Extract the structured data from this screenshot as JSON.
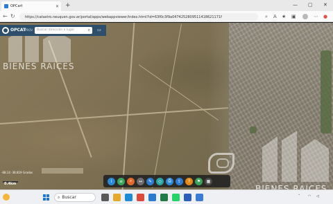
{
  "browser": {
    "tab_title": "OPCart",
    "url": "https://catastro.neuquen.gov.ar/portal/apps/webappviewer/index.html?id=63f0c3f9a0474252809511418621171f",
    "new_tab_label": "+",
    "minimize": "—",
    "maximize": "▢",
    "close": "✕"
  },
  "app": {
    "title": "OPCAT",
    "subtitle": "PROV.",
    "search_placeholder": "Buscar dirección o lugar"
  },
  "map": {
    "coordinates": "-68.14 -38.819 Grados",
    "scale": "0.4km"
  },
  "watermark": {
    "text": "BIENES RAICES"
  },
  "dock_widgets": [
    {
      "icon": "info-icon",
      "color": "#2b8ad8"
    },
    {
      "icon": "layers-icon",
      "color": "#3aa35c"
    },
    {
      "icon": "search-widget-icon",
      "color": "#e06a2a"
    },
    {
      "icon": "measure-icon",
      "color": "#6d6d6d"
    },
    {
      "icon": "draw-icon",
      "color": "#2d7cd1"
    },
    {
      "icon": "select-icon",
      "color": "#2aa3a3"
    },
    {
      "icon": "print-icon",
      "color": "#2b8ad8"
    },
    {
      "icon": "share-icon",
      "color": "#2d7cd1"
    },
    {
      "icon": "query-icon",
      "color": "#e58a1a"
    },
    {
      "icon": "bookmark-icon",
      "color": "#3aa35c"
    },
    {
      "icon": "basemap-icon",
      "color": "#4a4a4a"
    }
  ],
  "taskbar": {
    "search_label": "Buscar",
    "apps": [
      {
        "icon": "task-view-icon",
        "color": "#5a5a5a"
      },
      {
        "icon": "files-icon",
        "color": "#e5a92d"
      },
      {
        "icon": "edge-icon",
        "color": "#1f8ad6"
      },
      {
        "icon": "chrome-icon",
        "color": "#d94a3a"
      },
      {
        "icon": "photos-icon",
        "color": "#2a7bd0"
      },
      {
        "icon": "excel-icon",
        "color": "#1f7a45"
      },
      {
        "icon": "whatsapp-icon",
        "color": "#25d366"
      },
      {
        "icon": "word-icon",
        "color": "#2b5fb8"
      },
      {
        "icon": "mail-icon",
        "color": "#3a7bd5"
      }
    ]
  }
}
